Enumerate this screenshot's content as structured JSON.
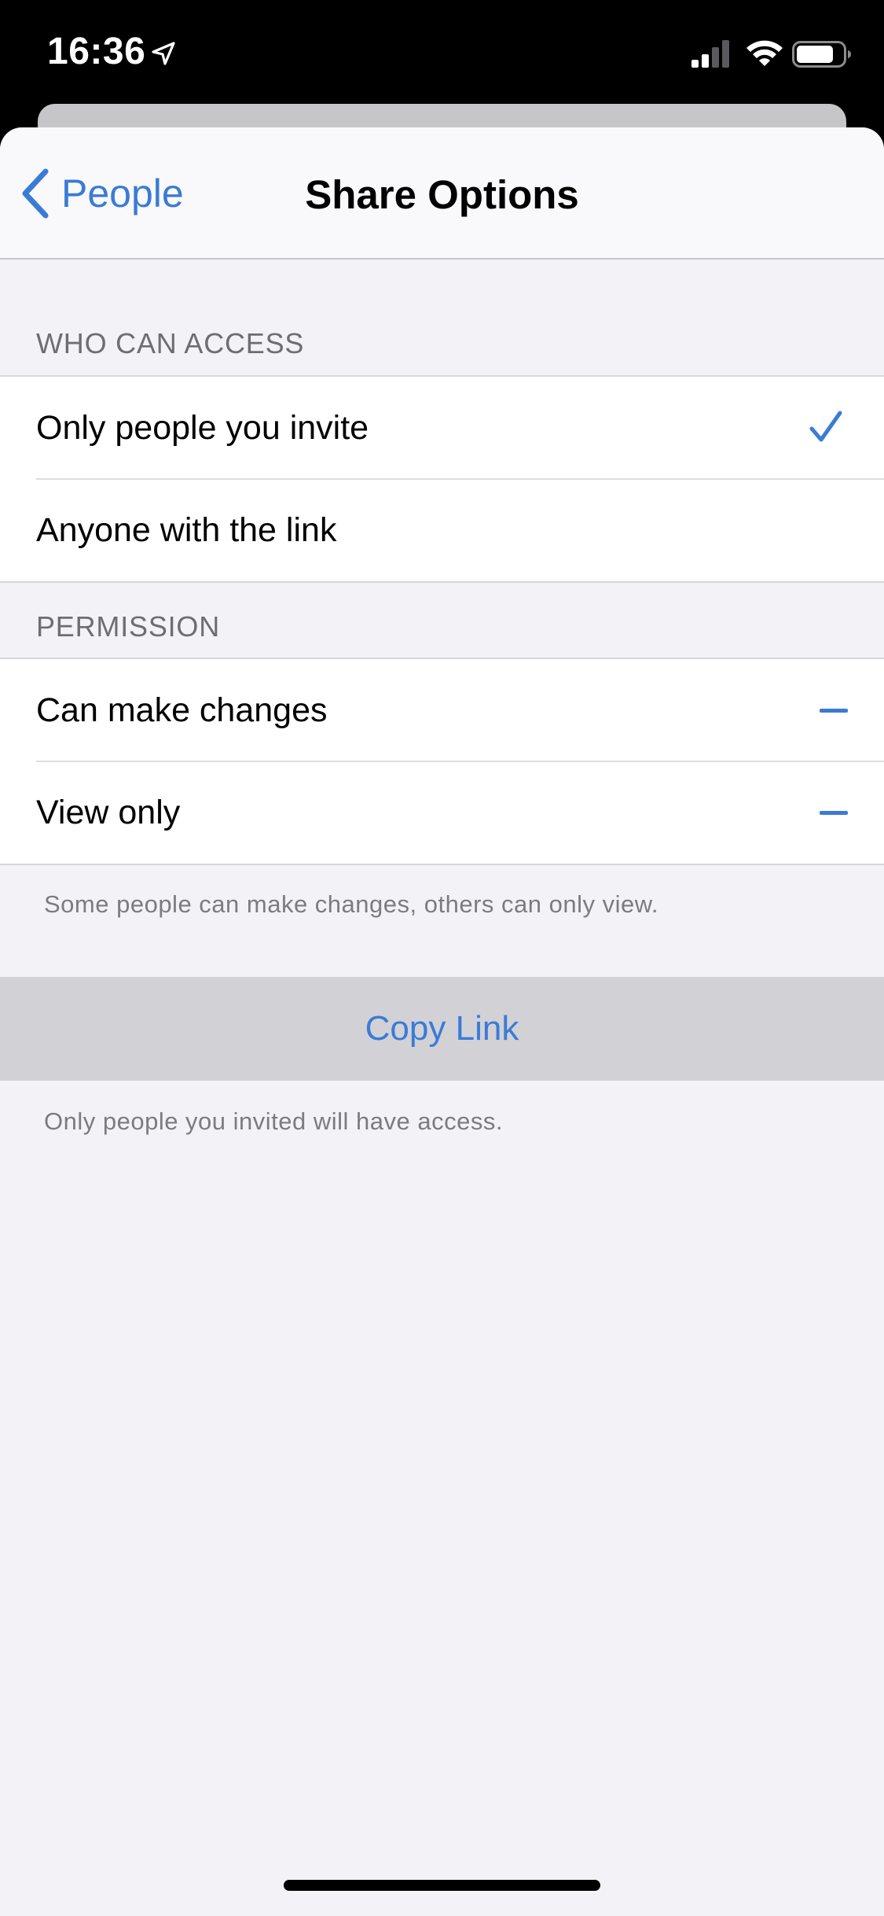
{
  "status_bar": {
    "time": "16:36",
    "icons": [
      "location-arrow-icon",
      "cellular-signal-icon",
      "wifi-icon",
      "battery-icon"
    ]
  },
  "nav": {
    "back_label": "People",
    "title": "Share Options"
  },
  "access_section": {
    "header": "WHO CAN ACCESS",
    "options": [
      {
        "label": "Only people you invite",
        "selected": true
      },
      {
        "label": "Anyone with the link",
        "selected": false
      }
    ]
  },
  "permission_section": {
    "header": "PERMISSION",
    "options": [
      {
        "label": "Can make changes",
        "state": "mixed"
      },
      {
        "label": "View only",
        "state": "mixed"
      }
    ],
    "footer": "Some people can make changes, others can only view."
  },
  "copy_link": {
    "label": "Copy Link",
    "footer": "Only people you invited will have access."
  },
  "colors": {
    "accent": "#3a7bd5",
    "background": "#f2f2f7",
    "status_bar": "#000000"
  }
}
